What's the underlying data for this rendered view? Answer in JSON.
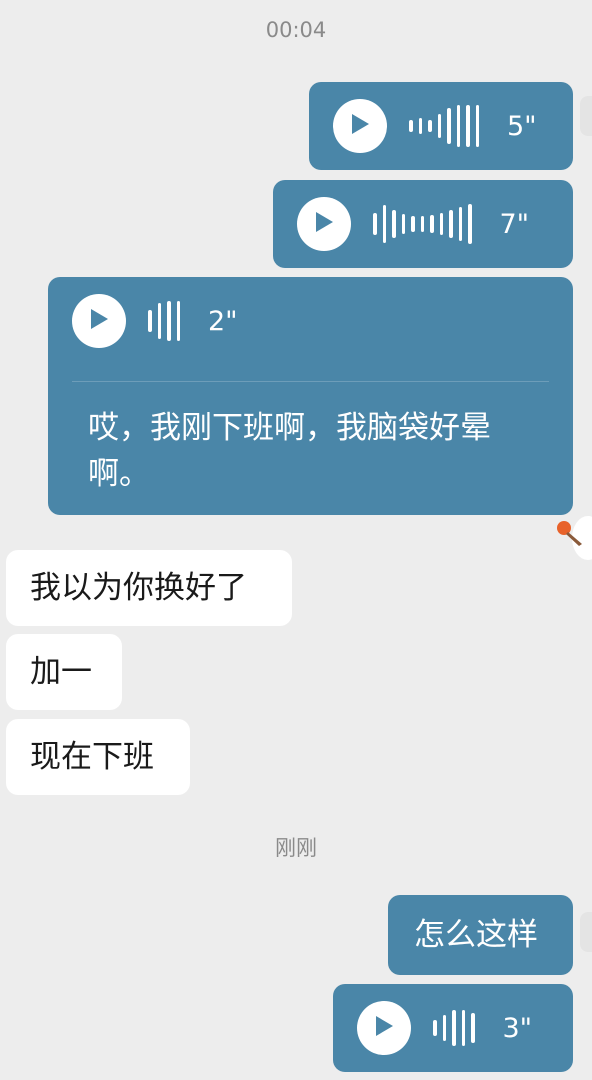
{
  "chat": {
    "timestamps": {
      "first": "00:04",
      "second": "刚刚"
    },
    "messages": [
      {
        "side": "out",
        "type": "voice",
        "duration": "5\""
      },
      {
        "side": "out",
        "type": "voice",
        "duration": "7\""
      },
      {
        "side": "out",
        "type": "voice",
        "duration": "2\"",
        "transcript": "哎，我刚下班啊，我脑袋好晕啊。"
      },
      {
        "side": "in",
        "type": "text",
        "text": "我以为你换好了"
      },
      {
        "side": "in",
        "type": "text",
        "text": "加一"
      },
      {
        "side": "in",
        "type": "text",
        "text": "现在下班"
      },
      {
        "side": "out",
        "type": "text",
        "text": "怎么这样"
      },
      {
        "side": "out",
        "type": "voice",
        "duration": "3\""
      }
    ]
  },
  "colors": {
    "outgoing_bubble": "#4a86a8",
    "incoming_bubble": "#ffffff",
    "background": "#ededed"
  },
  "icons": {
    "play": "play-icon",
    "waveform": "voice-waveform-icon"
  }
}
